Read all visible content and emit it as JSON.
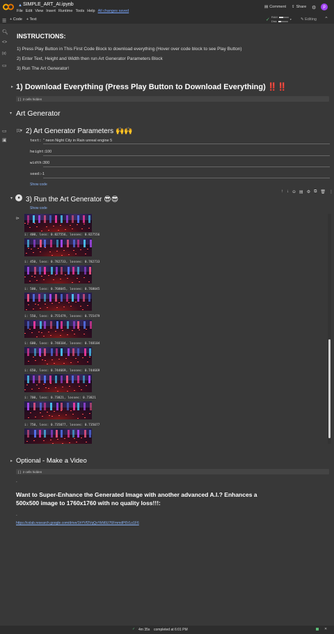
{
  "header": {
    "title": "SIMPLE_ART_AI.ipynb",
    "menu": [
      "File",
      "Edit",
      "View",
      "Insert",
      "Runtime",
      "Tools",
      "Help"
    ],
    "saved_status": "All changes saved",
    "comment_label": "Comment",
    "share_label": "Share",
    "avatar_letter": "p"
  },
  "toolbar": {
    "code_label": "+ Code",
    "text_label": "+ Text",
    "ram_label": "RAM",
    "disk_label": "Disk",
    "ram_usage": 0.45,
    "disk_usage": 0.3,
    "editing_label": "Editing"
  },
  "instructions": {
    "title": "INSTRUCTIONS:",
    "steps": [
      "1) Press Play Button in This First Code Block to download everything (Hover over code block to see Play Button)",
      "2) Enter Text, Height and Width then run Art Generator Parameters Block",
      "3) Run The Art Generator!"
    ]
  },
  "download_section": {
    "heading": "1) Download Everything (Press Play Button to Download Everything)",
    "marks": "‼️‼️",
    "hidden_cells": "2 cells hidden"
  },
  "art_section": {
    "heading": "Art Generator",
    "params_cell_number": "[1]",
    "params_heading": "2) Art Generator Parameters",
    "params_emoji": "🙌🙌",
    "params": [
      {
        "key": "text:",
        "value": "\" neon Night City in Rain unreal engine 5"
      },
      {
        "key": "height:",
        "value": "100"
      },
      {
        "key": "width:",
        "value": "300"
      },
      {
        "key": "seed:",
        "value": "-1"
      }
    ],
    "show_code": "Show code",
    "run_heading": "3) Run the Art Generator",
    "run_emoji": "😎😎",
    "run_show_code": "Show code"
  },
  "output_logs": [
    "i: 400, loss: 0.827556, losses: 0.827556",
    "i: 450, loss: 0.782733, losses: 0.782733",
    "i: 500, loss: 0.768045, losses: 0.768045",
    "i: 550, loss: 0.755479, losses: 0.755479",
    "i: 600, loss: 0.748104, losses: 0.748104",
    "i: 650, loss: 0.744669, losses: 0.744669",
    "i: 700, loss: 0.73821, losses: 0.73821",
    "i: 750, loss: 0.735077, losses: 0.735077"
  ],
  "optional_section": {
    "heading": "Optional - Make a Video",
    "hidden_cells": "2 cells hidden"
  },
  "enhance": {
    "text": "Want to Super-Enhance the Generated Image with another advanced A.I.? Enhances a 500x500 image to 1760x1760 with no quality loss!!!:",
    "link": "https://colab.research.google.com/drive/1hYVf2VqQxYkN6U76FmmdP6VLo1F6"
  },
  "status_bar": {
    "time": "4m 35s",
    "completed": "completed at 6:01 PM"
  },
  "colors": {
    "accent": "#8ab4f8",
    "run_green": "#5bb974",
    "avatar": "#a142f4",
    "alert_red": "#e5484d"
  }
}
